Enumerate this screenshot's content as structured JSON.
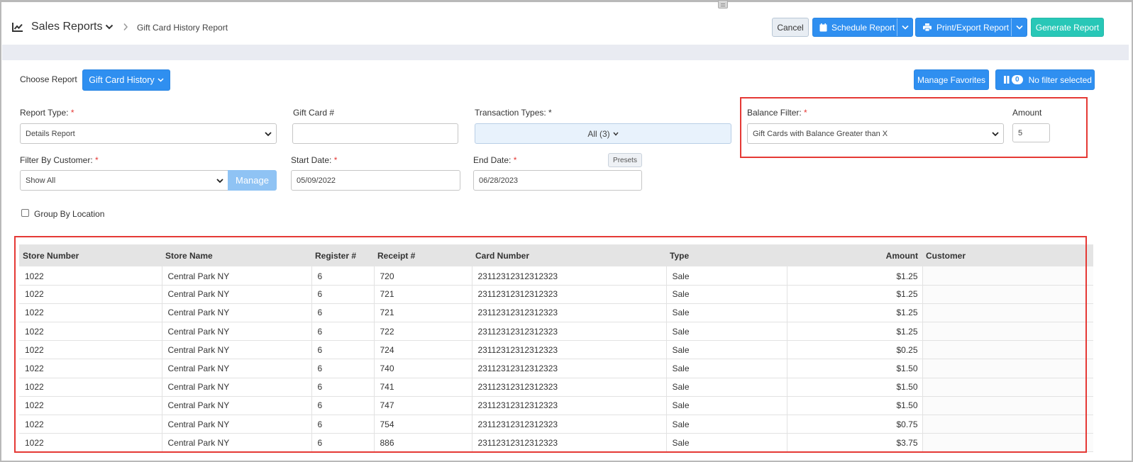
{
  "header": {
    "app_title": "Sales Reports",
    "breadcrumb": "Gift Card History Report",
    "cancel_label": "Cancel",
    "schedule_label": "Schedule Report",
    "print_label": "Print/Export Report",
    "generate_label": "Generate Report"
  },
  "panel": {
    "choose_report_label": "Choose Report",
    "choose_report_value": "Gift Card History",
    "manage_favorites_label": "Manage Favorites",
    "filter_count": "0",
    "filter_status": "No filter selected",
    "report_type_label": "Report Type:",
    "report_type_value": "Details Report",
    "gift_card_label": "Gift Card #",
    "gift_card_value": "",
    "transaction_types_label": "Transaction Types: *",
    "transaction_types_value": "All (3)",
    "balance_filter_label": "Balance Filter:",
    "balance_filter_value": "Gift Cards with Balance Greater than X",
    "amount_label": "Amount",
    "amount_value": "5",
    "filter_customer_label": "Filter By Customer:",
    "filter_customer_value": "Show All",
    "manage_label": "Manage",
    "start_date_label": "Start Date:",
    "start_date_value": "05/09/2022",
    "end_date_label": "End Date:",
    "end_date_value": "06/28/2023",
    "presets_label": "Presets",
    "group_by_label": "Group By Location",
    "required_mark": "*"
  },
  "table": {
    "columns": [
      "Store Number",
      "Store Name",
      "Register #",
      "Receipt #",
      "Card Number",
      "Type",
      "Amount",
      "Customer"
    ],
    "rows": [
      [
        "1022",
        "Central Park NY",
        "6",
        "720",
        "23112312312312323",
        "Sale",
        "$1.25"
      ],
      [
        "1022",
        "Central Park NY",
        "6",
        "721",
        "23112312312312323",
        "Sale",
        "$1.25"
      ],
      [
        "1022",
        "Central Park NY",
        "6",
        "721",
        "23112312312312323",
        "Sale",
        "$1.25"
      ],
      [
        "1022",
        "Central Park NY",
        "6",
        "722",
        "23112312312312323",
        "Sale",
        "$1.25"
      ],
      [
        "1022",
        "Central Park NY",
        "6",
        "724",
        "23112312312312323",
        "Sale",
        "$0.25"
      ],
      [
        "1022",
        "Central Park NY",
        "6",
        "740",
        "23112312312312323",
        "Sale",
        "$1.50"
      ],
      [
        "1022",
        "Central Park NY",
        "6",
        "741",
        "23112312312312323",
        "Sale",
        "$1.50"
      ],
      [
        "1022",
        "Central Park NY",
        "6",
        "747",
        "23112312312312323",
        "Sale",
        "$1.50"
      ],
      [
        "1022",
        "Central Park NY",
        "6",
        "754",
        "23112312312312323",
        "Sale",
        "$0.75"
      ],
      [
        "1022",
        "Central Park NY",
        "6",
        "886",
        "23112312312312323",
        "Sale",
        "$3.75"
      ]
    ]
  },
  "colors": {
    "primary_blue": "#2f8ff0",
    "teal": "#28c7b7",
    "highlight_red": "#e53935",
    "light_blue_field": "#e8f2fc"
  }
}
